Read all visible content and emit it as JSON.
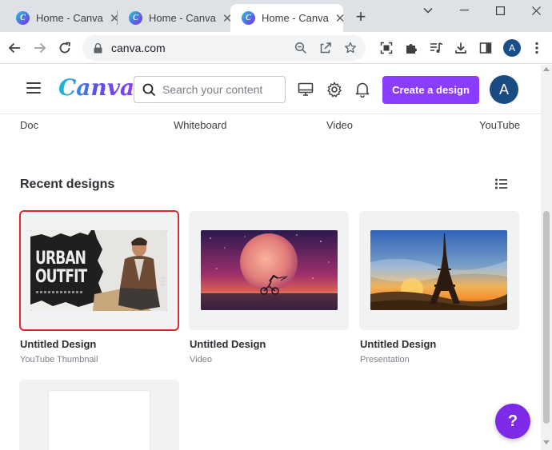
{
  "browser": {
    "tabs": [
      {
        "title": "Home - Canva",
        "favicon": "canva-favicon",
        "active": false
      },
      {
        "title": "Home - Canva",
        "favicon": "canva-favicon",
        "active": false
      },
      {
        "title": "Home - Canva",
        "favicon": "canva-favicon",
        "active": true
      }
    ],
    "favicon_letter": "C",
    "close_glyph": "✕",
    "new_tab_glyph": "+",
    "url": "canva.com",
    "profile_initial": "A"
  },
  "canva": {
    "logo": "Canva",
    "search_placeholder": "Search your content",
    "create_button": "Create a design",
    "avatar_initial": "A",
    "design_types": [
      "Doc",
      "Whiteboard",
      "Video",
      "YouTube"
    ],
    "recent_title": "Recent designs",
    "designs": [
      {
        "title": "Untitled Design",
        "type": "YouTube Thumbnail",
        "thumb_text_1": "URBAN",
        "thumb_text_2": "OUTFIT",
        "selected": true
      },
      {
        "title": "Untitled Design",
        "type": "Video",
        "selected": false
      },
      {
        "title": "Untitled Design",
        "type": "Presentation",
        "selected": false
      }
    ],
    "help_label": "?"
  },
  "colors": {
    "brand_purple": "#8b3dff",
    "selection_red": "#e5242b",
    "avatar_blue": "#1a4b84"
  }
}
